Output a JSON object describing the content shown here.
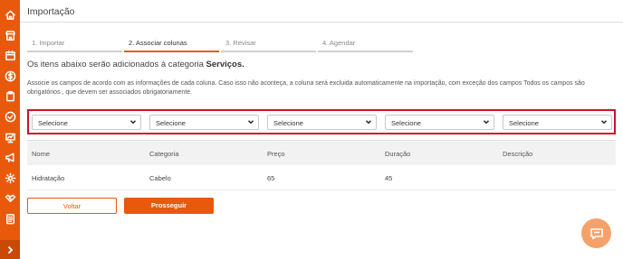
{
  "header": {
    "title": "Importação"
  },
  "steps": [
    {
      "label": "1. Importar",
      "active": false
    },
    {
      "label": "2. Associar colunas",
      "active": true
    },
    {
      "label": "3. Revisar",
      "active": false
    },
    {
      "label": "4. Agendar",
      "active": false
    }
  ],
  "info": {
    "title_prefix": "Os itens abaixo serão adicionados à categoria",
    "category": "Serviços.",
    "description": "Associe os campos de acordo com as informações de cada coluna. Caso isso não aconteça, a coluna será excluida automaticamente na importação, com exceção dos campos Todos os campos são obrigatórios , que devem ser associados obrigatoriamente."
  },
  "selects": [
    {
      "value": "Selecione"
    },
    {
      "value": "Selecione"
    },
    {
      "value": "Selecione"
    },
    {
      "value": "Selecione"
    },
    {
      "value": "Selecione"
    }
  ],
  "table": {
    "columns": [
      "Nome",
      "Categoria",
      "Preço",
      "Duração",
      "Descrição"
    ],
    "rows": [
      [
        "Hidratação",
        "Cabelo",
        "65",
        "45",
        ""
      ]
    ]
  },
  "buttons": {
    "back_label": "Voltar",
    "next_label": "Prosseguir"
  },
  "colors": {
    "accent": "#e8590c",
    "highlight_border": "#d0102c",
    "chat_bubble": "#f5a26a"
  },
  "sidebar": {
    "icons": [
      "home-icon",
      "store-icon",
      "calendar-icon",
      "dollar-icon",
      "clipboard-icon",
      "check-circle-icon",
      "presentation-icon",
      "megaphone-icon",
      "gear-icon",
      "handshake-icon",
      "document-icon"
    ],
    "expand_icon": "chevron-right-icon"
  }
}
